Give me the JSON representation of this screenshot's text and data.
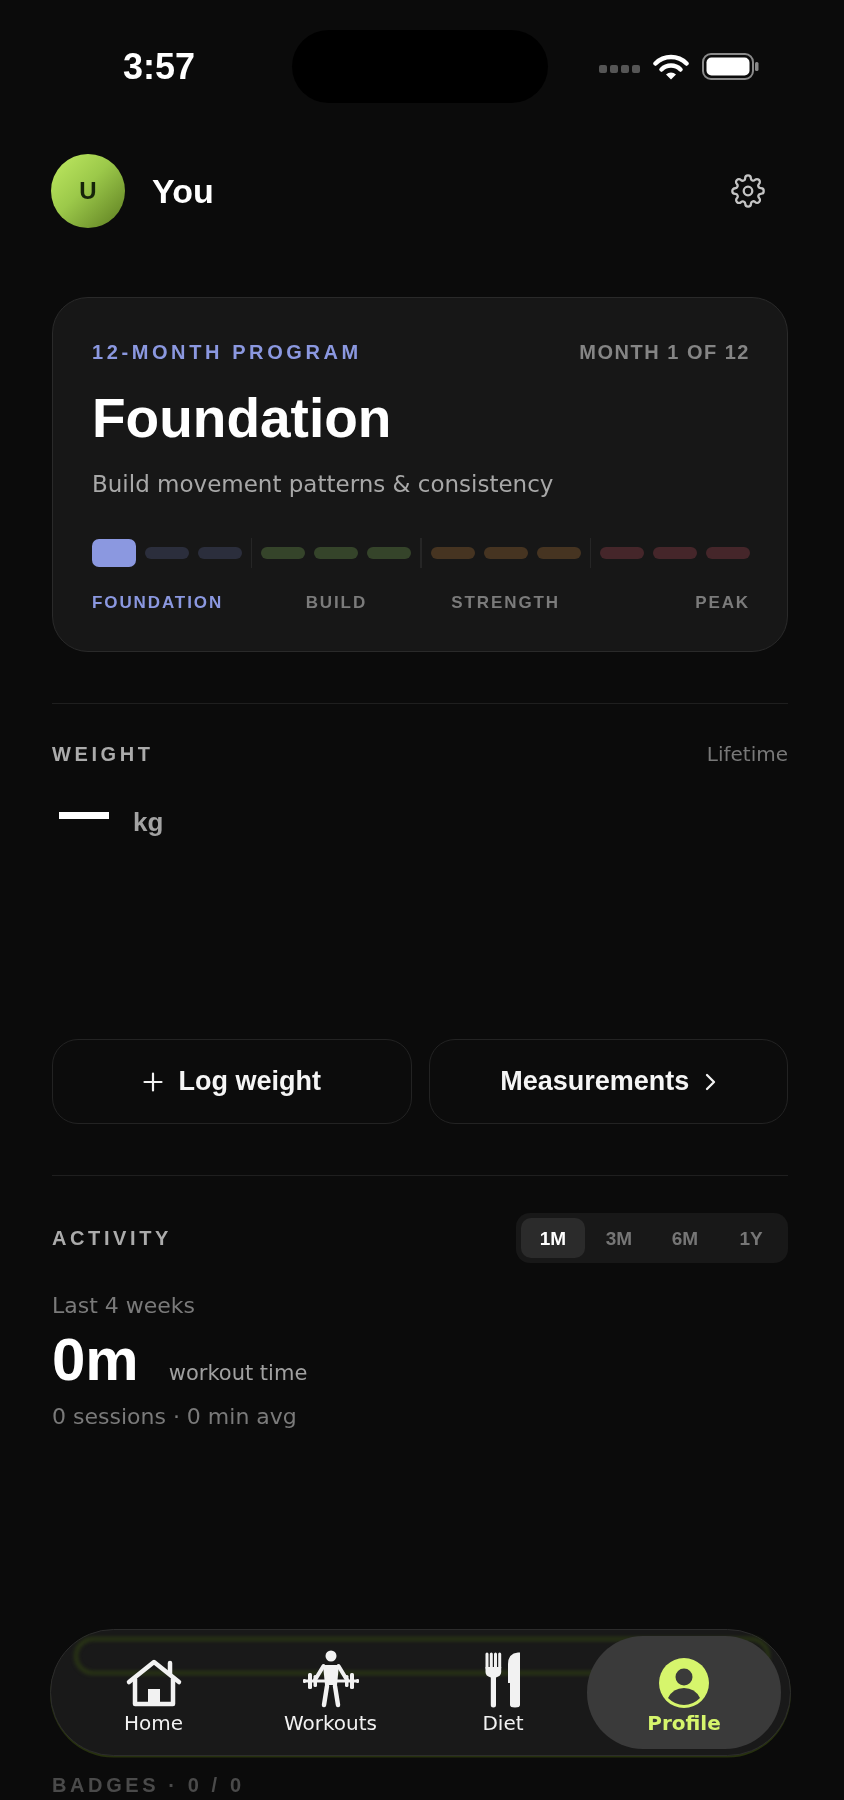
{
  "status_bar": {
    "time": "3:57"
  },
  "profile_header": {
    "avatar_initial": "U",
    "name": "You"
  },
  "program_card": {
    "eyebrow": "12-MONTH PROGRAM",
    "month_label": "MONTH 1 OF 12",
    "title": "Foundation",
    "description": "Build movement patterns & consistency",
    "phases": [
      {
        "label": "FOUNDATION",
        "current": true,
        "color": "#2b2e3c",
        "months": [
          {
            "current": true
          },
          {
            "current": false
          },
          {
            "current": false
          }
        ]
      },
      {
        "label": "BUILD",
        "current": false,
        "color": "#35442a",
        "months": [
          {
            "current": false
          },
          {
            "current": false
          },
          {
            "current": false
          }
        ]
      },
      {
        "label": "STRENGTH",
        "current": false,
        "color": "#463421",
        "months": [
          {
            "current": false
          },
          {
            "current": false
          },
          {
            "current": false
          }
        ]
      },
      {
        "label": "PEAK",
        "current": false,
        "color": "#45262a",
        "months": [
          {
            "current": false
          },
          {
            "current": false
          },
          {
            "current": false
          }
        ]
      }
    ]
  },
  "weight": {
    "heading": "WEIGHT",
    "range": "Lifetime",
    "value": "—",
    "unit": "kg",
    "actions": [
      {
        "kind": "add",
        "label": "Log weight"
      },
      {
        "kind": "open",
        "label": "Measurements"
      }
    ]
  },
  "activity": {
    "heading": "ACTIVITY",
    "ranges": [
      {
        "label": "1M",
        "selected": true
      },
      {
        "label": "3M",
        "selected": false
      },
      {
        "label": "6M",
        "selected": false
      },
      {
        "label": "1Y",
        "selected": false
      }
    ],
    "period": "Last 4 weeks",
    "total": "0m",
    "total_caption": "workout time",
    "summary": "0 sessions · 0 min avg"
  },
  "badges": {
    "heading": "BADGES · 0 / 0"
  },
  "tab_bar": {
    "tabs": [
      {
        "kind": "home",
        "label": "Home",
        "selected": false
      },
      {
        "kind": "workouts",
        "label": "Workouts",
        "selected": false
      },
      {
        "kind": "diet",
        "label": "Diet",
        "selected": false
      },
      {
        "kind": "profile",
        "label": "Profile",
        "selected": true
      }
    ]
  }
}
